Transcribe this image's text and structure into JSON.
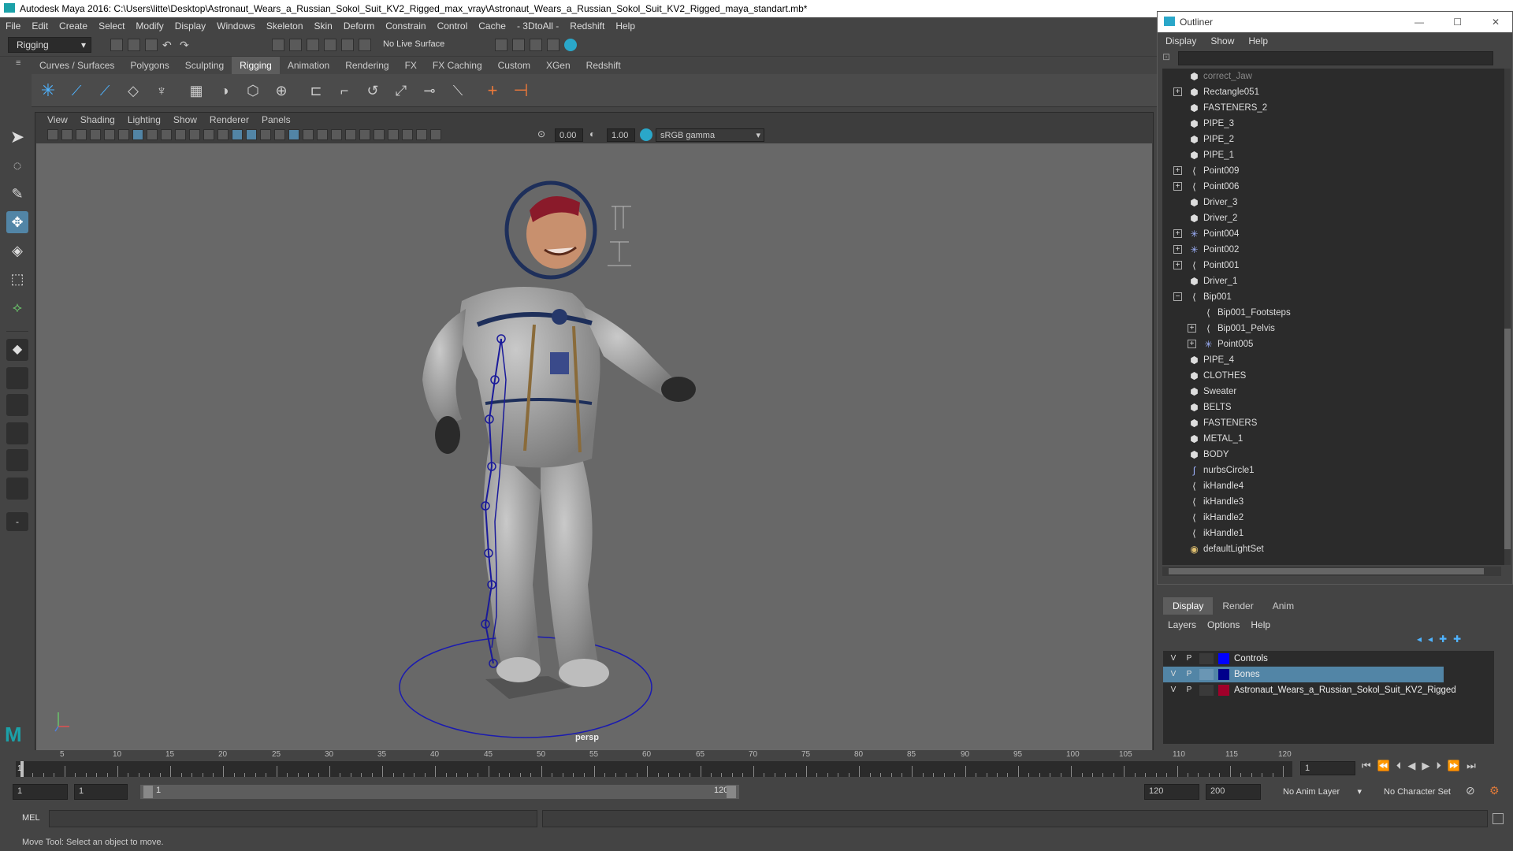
{
  "window": {
    "title": "Autodesk Maya 2016: C:\\Users\\litte\\Desktop\\Astronaut_Wears_a_Russian_Sokol_Suit_KV2_Rigged_max_vray\\Astronaut_Wears_a_Russian_Sokol_Suit_KV2_Rigged_maya_standart.mb*"
  },
  "menubar": [
    "File",
    "Edit",
    "Create",
    "Select",
    "Modify",
    "Display",
    "Windows",
    "Skeleton",
    "Skin",
    "Deform",
    "Constrain",
    "Control",
    "Cache",
    "- 3DtoAll -",
    "Redshift",
    "Help"
  ],
  "status_line": {
    "menu_set": "Rigging",
    "live_surface": "No Live Surface"
  },
  "shelf_tabs": [
    {
      "label": "Curves / Surfaces",
      "active": false
    },
    {
      "label": "Polygons",
      "active": false
    },
    {
      "label": "Sculpting",
      "active": false
    },
    {
      "label": "Rigging",
      "active": true
    },
    {
      "label": "Animation",
      "active": false
    },
    {
      "label": "Rendering",
      "active": false
    },
    {
      "label": "FX",
      "active": false
    },
    {
      "label": "FX Caching",
      "active": false
    },
    {
      "label": "Custom",
      "active": false
    },
    {
      "label": "XGen",
      "active": false
    },
    {
      "label": "Redshift",
      "active": false
    }
  ],
  "viewport": {
    "menus": [
      "View",
      "Shading",
      "Lighting",
      "Show",
      "Renderer",
      "Panels"
    ],
    "exposure": "0.00",
    "gamma": "1.00",
    "color_space": "sRGB gamma",
    "camera_label": "persp"
  },
  "outliner": {
    "title": "Outliner",
    "menus": [
      "Display",
      "Show",
      "Help"
    ],
    "items": [
      {
        "name": "correct_Jaw",
        "icon": "mesh-icon",
        "expand": "",
        "indent": 0
      },
      {
        "name": "Rectangle051",
        "icon": "mesh-icon",
        "expand": "+",
        "indent": 0
      },
      {
        "name": "FASTENERS_2",
        "icon": "mesh-icon",
        "expand": "",
        "indent": 0
      },
      {
        "name": "PIPE_3",
        "icon": "mesh-icon",
        "expand": "",
        "indent": 0
      },
      {
        "name": "PIPE_2",
        "icon": "mesh-icon",
        "expand": "",
        "indent": 0
      },
      {
        "name": "PIPE_1",
        "icon": "mesh-icon",
        "expand": "",
        "indent": 0
      },
      {
        "name": "Point009",
        "icon": "joint-icon",
        "expand": "+",
        "indent": 0
      },
      {
        "name": "Point006",
        "icon": "joint-icon",
        "expand": "+",
        "indent": 0
      },
      {
        "name": "Driver_3",
        "icon": "mesh-icon",
        "expand": "",
        "indent": 0
      },
      {
        "name": "Driver_2",
        "icon": "mesh-icon",
        "expand": "",
        "indent": 0
      },
      {
        "name": "Point004",
        "icon": "locator-icon",
        "expand": "+",
        "indent": 0
      },
      {
        "name": "Point002",
        "icon": "locator-icon",
        "expand": "+",
        "indent": 0
      },
      {
        "name": "Point001",
        "icon": "joint-icon",
        "expand": "+",
        "indent": 0
      },
      {
        "name": "Driver_1",
        "icon": "mesh-icon",
        "expand": "",
        "indent": 0
      },
      {
        "name": "Bip001",
        "icon": "joint-icon",
        "expand": "-",
        "indent": 0
      },
      {
        "name": "Bip001_Footsteps",
        "icon": "joint-icon",
        "expand": "",
        "indent": 1
      },
      {
        "name": "Bip001_Pelvis",
        "icon": "joint-icon",
        "expand": "+",
        "indent": 1
      },
      {
        "name": "Point005",
        "icon": "locator-icon",
        "expand": "+",
        "indent": 1
      },
      {
        "name": "PIPE_4",
        "icon": "mesh-icon",
        "expand": "",
        "indent": 0
      },
      {
        "name": "CLOTHES",
        "icon": "mesh-icon",
        "expand": "",
        "indent": 0
      },
      {
        "name": "Sweater",
        "icon": "mesh-icon",
        "expand": "",
        "indent": 0
      },
      {
        "name": "BELTS",
        "icon": "mesh-icon",
        "expand": "",
        "indent": 0
      },
      {
        "name": "FASTENERS",
        "icon": "mesh-icon",
        "expand": "",
        "indent": 0
      },
      {
        "name": "METAL_1",
        "icon": "mesh-icon",
        "expand": "",
        "indent": 0
      },
      {
        "name": "BODY",
        "icon": "mesh-icon",
        "expand": "",
        "indent": 0
      },
      {
        "name": "nurbsCircle1",
        "icon": "curve-icon",
        "expand": "",
        "indent": 0
      },
      {
        "name": "ikHandle4",
        "icon": "ik-icon",
        "expand": "",
        "indent": 0
      },
      {
        "name": "ikHandle3",
        "icon": "ik-icon",
        "expand": "",
        "indent": 0
      },
      {
        "name": "ikHandle2",
        "icon": "ik-icon",
        "expand": "",
        "indent": 0
      },
      {
        "name": "ikHandle1",
        "icon": "ik-icon",
        "expand": "",
        "indent": 0
      },
      {
        "name": "defaultLightSet",
        "icon": "set-icon",
        "expand": "",
        "indent": 0
      }
    ]
  },
  "layers": {
    "tabs": [
      {
        "label": "Display",
        "active": true
      },
      {
        "label": "Render",
        "active": false
      },
      {
        "label": "Anim",
        "active": false
      }
    ],
    "menus": [
      "Layers",
      "Options",
      "Help"
    ],
    "rows": [
      {
        "v": "V",
        "p": "P",
        "name": "Controls",
        "color": "#0000ff",
        "selected": false
      },
      {
        "v": "V",
        "p": "P",
        "name": "Bones",
        "color": "#00008b",
        "selected": true
      },
      {
        "v": "V",
        "p": "P",
        "name": "Astronaut_Wears_a_Russian_Sokol_Suit_KV2_Rigged",
        "color": "#a0002a",
        "selected": false
      }
    ]
  },
  "timeline": {
    "ticks": [
      "5",
      "10",
      "15",
      "20",
      "25",
      "30",
      "35",
      "40",
      "45",
      "50",
      "55",
      "60",
      "65",
      "70",
      "75",
      "80",
      "85",
      "90",
      "95",
      "100",
      "105",
      "110",
      "115",
      "120"
    ],
    "current_frame": "1",
    "playhead_label": "1"
  },
  "range": {
    "start": "1",
    "playback_start": "1",
    "slider_start": "1",
    "slider_end": "120",
    "playback_end": "120",
    "end": "200",
    "anim_layer": "No Anim Layer",
    "character_set": "No Character Set"
  },
  "command": {
    "lang": "MEL"
  },
  "help_line": "Move Tool: Select an object to move."
}
